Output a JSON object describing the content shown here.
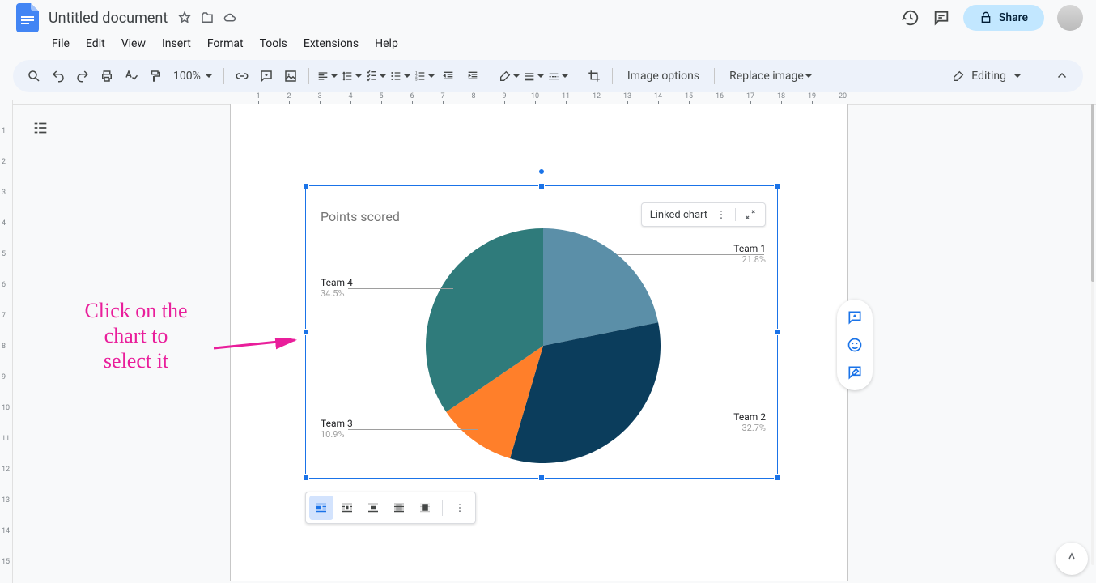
{
  "header": {
    "doc_title": "Untitled document",
    "share_label": "Share"
  },
  "menus": [
    "File",
    "Edit",
    "View",
    "Insert",
    "Format",
    "Tools",
    "Extensions",
    "Help"
  ],
  "toolbar": {
    "zoom": "100%",
    "image_options": "Image options",
    "replace_image": "Replace image",
    "mode": "Editing"
  },
  "annotation": {
    "line1": "Click on the",
    "line2": "chart to",
    "line3": "select it"
  },
  "linked_chip": {
    "label": "Linked chart"
  },
  "chart_data": {
    "type": "pie",
    "title": "Points scored",
    "series": [
      {
        "name": "Team 1",
        "value": 21.8,
        "label": "21.8%",
        "color": "#5b8fa8"
      },
      {
        "name": "Team 2",
        "value": 32.7,
        "label": "32.7%",
        "color": "#0b3d5c"
      },
      {
        "name": "Team 3",
        "value": 10.9,
        "label": "10.9%",
        "color": "#ff7f2a"
      },
      {
        "name": "Team 4",
        "value": 34.5,
        "label": "34.5%",
        "color": "#2f7b7b"
      }
    ]
  }
}
